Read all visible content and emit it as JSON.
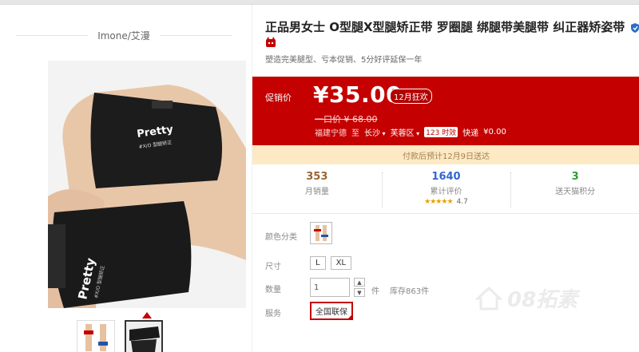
{
  "brand": {
    "name": "Imone/艾漫"
  },
  "product": {
    "title": "正品男女士 O型腿X型腿矫正带 罗圈腿 绑腿带美腿带 纠正器矫姿带",
    "subtitle": "塑造完美腿型、亏本促销、5分好评延保一年",
    "icons": {
      "gov": "shield-icon",
      "tmall": "tmall-cat-icon"
    }
  },
  "price": {
    "label": "促销价",
    "current": "¥35.00",
    "promo_badge": "12月狂欢",
    "original_label": "一口价",
    "original": "¥ 68.00",
    "ship_from": "福建宁德",
    "ship_to_label": "至",
    "ship_city": "长沙",
    "ship_district": "芙蓉区",
    "ship_time_badge": "123 时效",
    "ship_fee_label": "快递",
    "ship_fee": "¥0.00"
  },
  "delivery_note": "付款后预计12月9日送达",
  "stats": [
    {
      "value": "353",
      "label": "月销量",
      "color": "#996633"
    },
    {
      "value": "1640",
      "label": "累计评价",
      "color": "#3366cc",
      "stars": "★★★★★",
      "score": "4.7"
    },
    {
      "value": "3",
      "label": "送天猫积分",
      "color": "#339933"
    }
  ],
  "options": {
    "color_label": "颜色分类",
    "size_label": "尺寸",
    "sizes": [
      "L",
      "XL"
    ],
    "qty_label": "数量",
    "qty_value": "1",
    "qty_unit": "件",
    "stock": "库存863件",
    "service_label": "服务",
    "service_value": "全国联保"
  },
  "watermark": {
    "text": "08拓素"
  },
  "colors": {
    "accent": "#c40000",
    "delivery_bg": "#fde9c4"
  }
}
